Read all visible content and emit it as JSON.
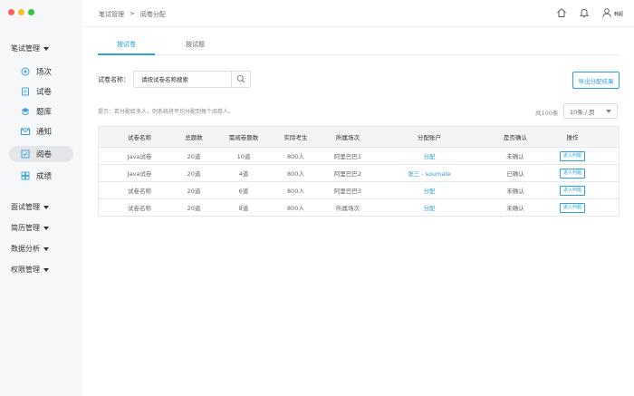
{
  "sidebar": {
    "groups": {
      "exam_mgmt": "笔试管理",
      "interview_mgmt": "面试管理",
      "resume_mgmt": "简历管理",
      "data_analysis": "数据分析",
      "permission_mgmt": "权限管理"
    },
    "items": [
      {
        "label": "场次",
        "icon": "venue-icon"
      },
      {
        "label": "试卷",
        "icon": "paper-icon"
      },
      {
        "label": "题库",
        "icon": "question-bank-icon"
      },
      {
        "label": "通知",
        "icon": "mail-icon"
      },
      {
        "label": "阅卷",
        "icon": "marking-icon",
        "active": true
      },
      {
        "label": "成绩",
        "icon": "score-icon"
      }
    ]
  },
  "header": {
    "breadcrumb": [
      "笔试管理",
      ">",
      "阅卷分配"
    ],
    "username": "韩超"
  },
  "tabs": [
    "按试卷",
    "按试题"
  ],
  "search": {
    "label": "试卷名称：",
    "placeholder": "请按试卷名称搜索"
  },
  "export_label": "导出分配结果",
  "hint": "提示：若分配给多人，则系统将平均分配到每个阅卷人。",
  "pagination": {
    "total": "共100条",
    "page_size": "10条 / 页"
  },
  "table": {
    "columns": [
      "试卷名称",
      "总题数",
      "需阅卷题数",
      "实际考生",
      "所属场次",
      "分配账户",
      "是否确认",
      "操作"
    ],
    "rows": [
      [
        "Java试卷",
        "20道",
        "10道",
        "800人",
        "阿里巴巴1",
        "分配",
        "未确认",
        "进入判题"
      ],
      [
        "Java试卷",
        "20道",
        "4道",
        "800人",
        "阿里巴巴2",
        "张三 - soumate",
        "已确认",
        "进入判题"
      ],
      [
        "试卷名称",
        "20道",
        "6道",
        "800人",
        "阿里巴巴3",
        "分配",
        "未确认",
        "进入判题"
      ],
      [
        "试卷名称",
        "20道",
        "8道",
        "800人",
        "所属场次",
        "分配",
        "未确认",
        "进入判题"
      ]
    ]
  },
  "colors": {
    "accent": "#2fa0d8",
    "sidebar_bg": "#f6f7f9"
  }
}
